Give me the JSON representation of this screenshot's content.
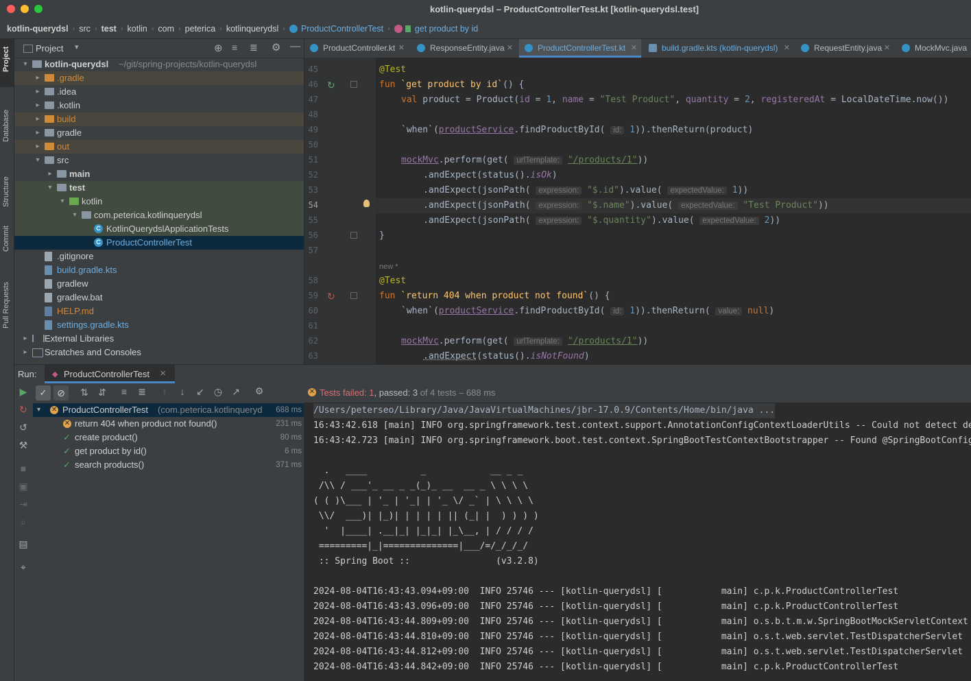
{
  "window": {
    "title": "kotlin-querydsl – ProductControllerTest.kt [kotlin-querydsl.test]"
  },
  "breadcrumbs": [
    "kotlin-querydsl",
    "src",
    "test",
    "kotlin",
    "com",
    "peterica",
    "kotlinquerydsl",
    "ProductControllerTest",
    "get product by id"
  ],
  "left_stripe": [
    "Project",
    "Database",
    "Structure",
    "Commit",
    "Pull Requests"
  ],
  "project": {
    "title": "Project",
    "tree": [
      {
        "label": "kotlin-querydsl",
        "extra": "~/git/spring-projects/kotlin-querydsl",
        "depth": 0,
        "arrow": "down",
        "kind": "folder-mod"
      },
      {
        "label": ".gradle",
        "depth": 1,
        "arrow": "right",
        "kind": "folder-excluded"
      },
      {
        "label": ".idea",
        "depth": 1,
        "arrow": "right",
        "kind": "folder"
      },
      {
        "label": ".kotlin",
        "depth": 1,
        "arrow": "right",
        "kind": "folder"
      },
      {
        "label": "build",
        "depth": 1,
        "arrow": "right",
        "kind": "folder-excluded"
      },
      {
        "label": "gradle",
        "depth": 1,
        "arrow": "right",
        "kind": "folder"
      },
      {
        "label": "out",
        "depth": 1,
        "arrow": "right",
        "kind": "folder-excluded"
      },
      {
        "label": "src",
        "depth": 1,
        "arrow": "down",
        "kind": "folder"
      },
      {
        "label": "main",
        "depth": 2,
        "arrow": "right",
        "kind": "folder-src"
      },
      {
        "label": "test",
        "depth": 2,
        "arrow": "down",
        "kind": "folder-test"
      },
      {
        "label": "kotlin",
        "depth": 3,
        "arrow": "down",
        "kind": "folder-test-root"
      },
      {
        "label": "com.peterica.kotlinquerydsl",
        "depth": 4,
        "arrow": "down",
        "kind": "package"
      },
      {
        "label": "KotlinQuerydslApplicationTests",
        "depth": 5,
        "arrow": "",
        "kind": "class"
      },
      {
        "label": "ProductControllerTest",
        "depth": 5,
        "arrow": "",
        "kind": "class-selected"
      },
      {
        "label": ".gitignore",
        "depth": 1,
        "arrow": "",
        "kind": "file"
      },
      {
        "label": "build.gradle.kts",
        "depth": 1,
        "arrow": "",
        "kind": "gradle"
      },
      {
        "label": "gradlew",
        "depth": 1,
        "arrow": "",
        "kind": "file"
      },
      {
        "label": "gradlew.bat",
        "depth": 1,
        "arrow": "",
        "kind": "file"
      },
      {
        "label": "HELP.md",
        "depth": 1,
        "arrow": "",
        "kind": "md"
      },
      {
        "label": "settings.gradle.kts",
        "depth": 1,
        "arrow": "",
        "kind": "gradle"
      },
      {
        "label": "External Libraries",
        "depth": 0,
        "arrow": "right",
        "kind": "libs"
      },
      {
        "label": "Scratches and Consoles",
        "depth": 0,
        "arrow": "right",
        "kind": "scratch"
      }
    ]
  },
  "editor": {
    "tabs": [
      {
        "label": "ProductController.kt",
        "active": false
      },
      {
        "label": "ResponseEntity.java",
        "active": false
      },
      {
        "label": "ProductControllerTest.kt",
        "active": true
      },
      {
        "label": "build.gradle.kts (kotlin-querydsl)",
        "active": false
      },
      {
        "label": "RequestEntity.java",
        "active": false
      },
      {
        "label": "MockMvc.java",
        "active": false
      }
    ],
    "lines": [
      "45",
      "46",
      "47",
      "48",
      "49",
      "50",
      "51",
      "52",
      "53",
      "54",
      "55",
      "56",
      "57",
      "",
      "58",
      "59",
      "60",
      "61",
      "62",
      "63"
    ],
    "new_marker": "new *",
    "code": {
      "l45_annot": "@Test",
      "l46_kw": "fun",
      "l46_name": "`get product by id`",
      "l46_rest": "() {",
      "l47_kw": "val",
      "l47_a": " product = Product(",
      "l47_p1": "id",
      "l47_eq": " = ",
      "l47_v1": "1",
      "l47_c1": ", ",
      "l47_p2": "name",
      "l47_v2": "\"Test Product\"",
      "l47_p3": "quantity",
      "l47_v3": "2",
      "l47_p4": "registeredAt",
      "l47_end": "LocalDateTime.now())",
      "l49_a": "`when`(",
      "l49_svc": "productService",
      "l49_b": ".findProductById(",
      "l49_hint": "id:",
      "l49_v": "1",
      "l49_c": ")).thenReturn(product)",
      "l51_mvc": "mockMvc",
      "l51_a": ".perform(get(",
      "l51_hint": "urlTemplate:",
      "l51_str": "\"/products/1\"",
      "l51_b": "))",
      "l52_a": ".andExpect(status().",
      "l52_b": "isOk",
      "l52_c": ")",
      "l53_a": ".andExpect(jsonPath(",
      "l53_hint": "expression:",
      "l53_str": "\"$.id\"",
      "l53_b": ").value(",
      "l53_hint2": "expectedValue:",
      "l53_v": "1",
      "l53_c": "))",
      "l54_str": "\"$.name\"",
      "l54_v": "\"Test Product\"",
      "l55_str": "\"$.quantity\"",
      "l55_v": "2",
      "l56": "}",
      "l58_annot": "@Test",
      "l59_name": "`return 404 when product not found`",
      "l60_hint": "value:",
      "l60_v": "null",
      "l60_a": ")).thenReturn(",
      "l60_c": ")",
      "l63_a": ".andExpect",
      "l63_b": "(status().",
      "l63_c": "isNotFound",
      "l63_d": ")"
    }
  },
  "run": {
    "label": "Run:",
    "tab": "ProductControllerTest",
    "status_failed": "Tests failed: ",
    "failed_count": "1",
    "status_passed": ", passed: ",
    "passed_count": "3",
    "status_rest": " of 4 tests – 688 ms",
    "tests": [
      {
        "name": "ProductControllerTest",
        "detail": "(com.peterica.kotlinqueryd",
        "time": "688 ms",
        "status": "fail",
        "root": true
      },
      {
        "name": "return 404 when product not found()",
        "time": "231 ms",
        "status": "fail"
      },
      {
        "name": "create product()",
        "time": "80 ms",
        "status": "pass"
      },
      {
        "name": "get product by id()",
        "time": "6 ms",
        "status": "pass"
      },
      {
        "name": "search products()",
        "time": "371 ms",
        "status": "pass"
      }
    ],
    "console": [
      "/Users/peterseo/Library/Java/JavaVirtualMachines/jbr-17.0.9/Contents/Home/bin/java ...",
      "16:43:42.618 [main] INFO org.springframework.test.context.support.AnnotationConfigContextLoaderUtils -- Could not detect de",
      "16:43:42.723 [main] INFO org.springframework.boot.test.context.SpringBootTestContextBootstrapper -- Found @SpringBootConfig",
      "",
      "  .   ____          _            __ _ _",
      " /\\\\ / ___'_ __ _ _(_)_ __  __ _ \\ \\ \\ \\",
      "( ( )\\___ | '_ | '_| | '_ \\/ _` | \\ \\ \\ \\",
      " \\\\/  ___)| |_)| | | | | || (_| |  ) ) ) )",
      "  '  |____| .__|_| |_|_| |_\\__, | / / / /",
      " =========|_|==============|___/=/_/_/_/",
      " :: Spring Boot ::                (v3.2.8)",
      "",
      "2024-08-04T16:43:43.094+09:00  INFO 25746 --- [kotlin-querydsl] [           main] c.p.k.ProductControllerTest",
      "2024-08-04T16:43:43.096+09:00  INFO 25746 --- [kotlin-querydsl] [           main] c.p.k.ProductControllerTest",
      "2024-08-04T16:43:44.809+09:00  INFO 25746 --- [kotlin-querydsl] [           main] o.s.b.t.m.w.SpringBootMockServletContext",
      "2024-08-04T16:43:44.810+09:00  INFO 25746 --- [kotlin-querydsl] [           main] o.s.t.web.servlet.TestDispatcherServlet",
      "2024-08-04T16:43:44.812+09:00  INFO 25746 --- [kotlin-querydsl] [           main] o.s.t.web.servlet.TestDispatcherServlet",
      "2024-08-04T16:43:44.842+09:00  INFO 25746 --- [kotlin-querydsl] [           main] c.p.k.ProductControllerTest"
    ]
  },
  "colors": {
    "accent": "#4a88c7",
    "pass": "#59a869",
    "fail": "#e3a34c",
    "excluded": "#d08a3a",
    "selection": "#0d293e"
  }
}
